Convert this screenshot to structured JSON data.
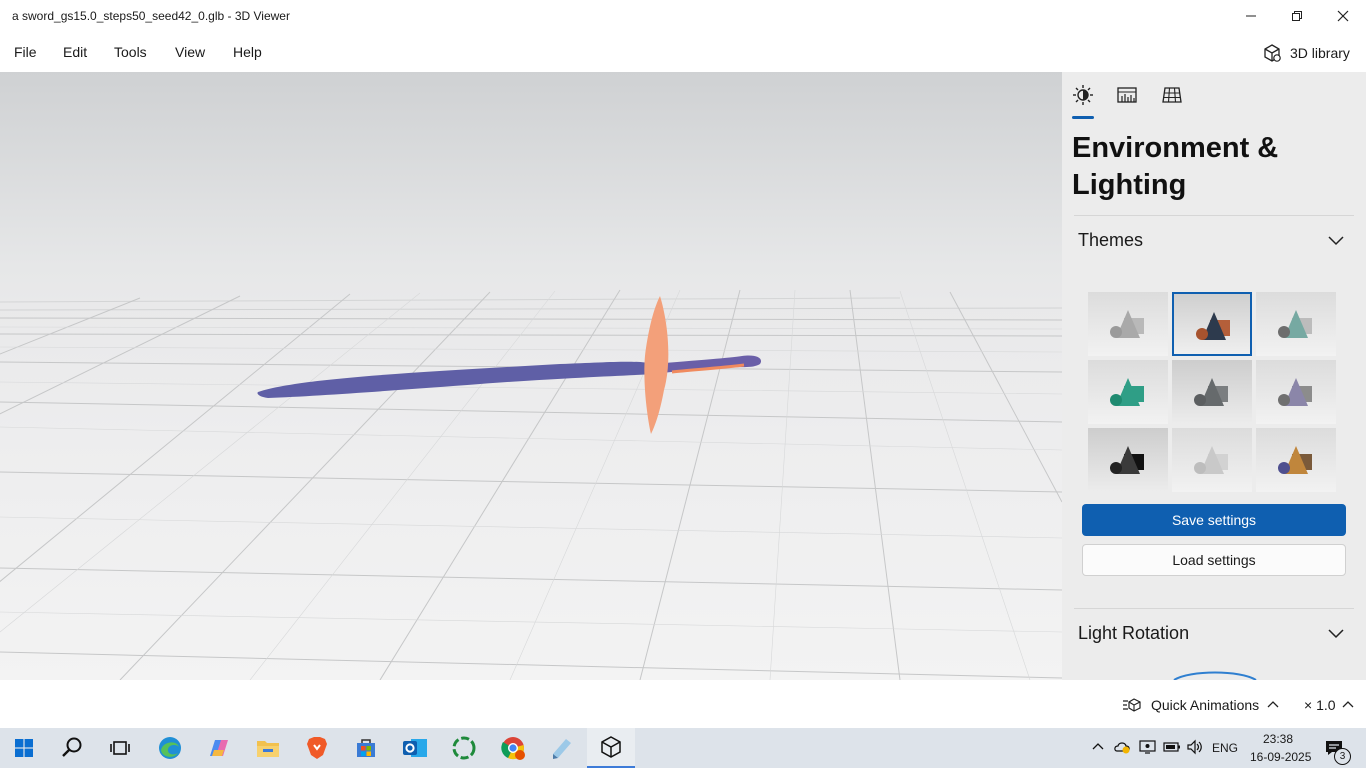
{
  "window": {
    "title": "a sword_gs15.0_steps50_seed42_0.glb - 3D Viewer"
  },
  "menu": {
    "file": "File",
    "edit": "Edit",
    "tools": "Tools",
    "view": "View",
    "help": "Help",
    "library": "3D library"
  },
  "panel": {
    "tabs": [
      "environment-lighting",
      "stats-shading",
      "grid-views"
    ],
    "active_tab": 0,
    "title": "Environment & Lighting",
    "themes_label": "Themes",
    "themes": [
      {
        "name": "gray-light",
        "shape": "#a9a9a9",
        "box": "#b9b9b9",
        "ball": "#9a9a9a",
        "selected": false
      },
      {
        "name": "dark-orange",
        "shape": "#2d3a4d",
        "box": "#b45f3a",
        "ball": "#a7532e",
        "selected": true
      },
      {
        "name": "teal-light",
        "shape": "#76a9a2",
        "box": "#bcbcbc",
        "ball": "#6d6d6d",
        "selected": false
      },
      {
        "name": "teal",
        "shape": "#2f9e86",
        "box": "#2f9e86",
        "ball": "#1f8a70",
        "selected": false
      },
      {
        "name": "dark-gray",
        "shape": "#666a6c",
        "box": "#7b7e80",
        "ball": "#5b5e60",
        "selected": false
      },
      {
        "name": "purple-gray",
        "shape": "#8b86a9",
        "box": "#8c8c8c",
        "ball": "#707070",
        "selected": false
      },
      {
        "name": "black",
        "shape": "#3a3a3a",
        "box": "#111111",
        "ball": "#222222",
        "selected": false
      },
      {
        "name": "white",
        "shape": "#c9c9c9",
        "box": "#d2d2d2",
        "ball": "#bdbdbd",
        "selected": false
      },
      {
        "name": "warm",
        "shape": "#c0863c",
        "box": "#7a5a3a",
        "ball": "#4e4f8f",
        "selected": false
      }
    ],
    "save_label": "Save settings",
    "load_label": "Load settings",
    "light_rotation_label": "Light Rotation"
  },
  "status": {
    "quick_animations": "Quick Animations",
    "speed": "× 1.0"
  },
  "taskbar": {
    "apps": [
      "start-icon",
      "search-icon",
      "task-view-icon",
      "edge-icon",
      "copilot-icon",
      "file-explorer-icon",
      "brave-icon",
      "store-icon",
      "outlook-icon",
      "xbox-icon",
      "chrome-icon",
      "paint-icon",
      "3d-viewer-icon"
    ],
    "language": "ENG",
    "time": "23:38",
    "date": "16-09-2025",
    "notifications": "3"
  },
  "colors": {
    "accent": "#0f5fb0",
    "blade": "#5f5fa6",
    "guard": "#f3a07a"
  }
}
